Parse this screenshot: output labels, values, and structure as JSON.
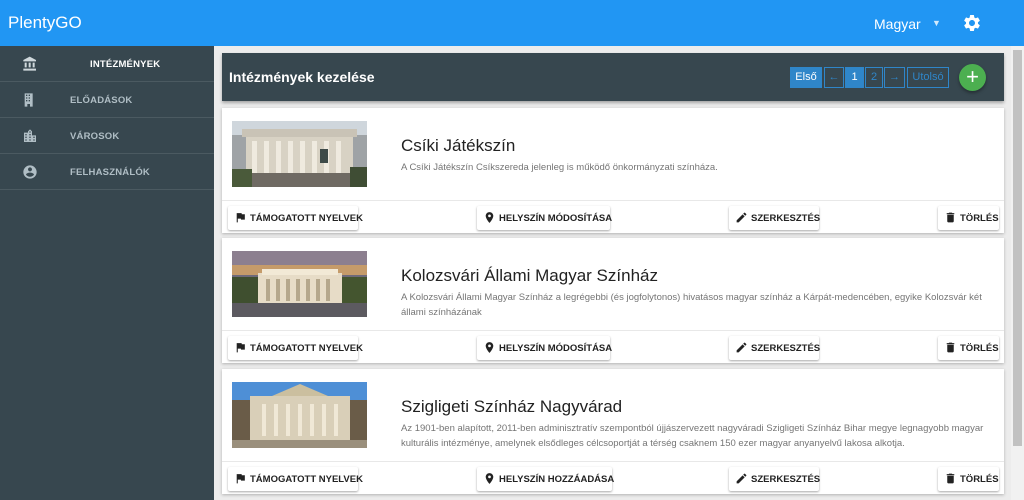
{
  "app": {
    "title": "PlentyGO"
  },
  "header_bar": {
    "language": "Magyar"
  },
  "sidebar": {
    "items": [
      {
        "label": "INTÉZMÉNYEK",
        "icon": "bank-icon",
        "active": true
      },
      {
        "label": "ELŐADÁSOK",
        "icon": "building-icon",
        "active": false
      },
      {
        "label": "VÁROSOK",
        "icon": "city-icon",
        "active": false
      },
      {
        "label": "FELHASZNÁLÓK",
        "icon": "account-circle-icon",
        "active": false
      }
    ]
  },
  "panel": {
    "title": "Intézmények kezelése",
    "pagination": {
      "first": "Első",
      "prev": "←",
      "pages": [
        "1",
        "2"
      ],
      "current": "1",
      "next": "→",
      "last": "Utolsó"
    },
    "add_label": "+"
  },
  "institutions": [
    {
      "name": "Csíki Játékszín",
      "description": "A Csíki Játékszín Csíkszereda jelenleg is működő önkormányzati színháza.",
      "actions": [
        "TÁMOGATOTT NYELVEK",
        "HELYSZÍN MÓDOSÍTÁSA",
        "SZERKESZTÉS",
        "TÖRLÉS"
      ]
    },
    {
      "name": "Kolozsvári Állami Magyar Színház",
      "description": "A Kolozsvári Állami Magyar Színház a legrégebbi (és jogfolytonos) hivatásos magyar színház a Kárpát-medencében, egyike Kolozsvár két állami színházának",
      "actions": [
        "TÁMOGATOTT NYELVEK",
        "HELYSZÍN MÓDOSÍTÁSA",
        "SZERKESZTÉS",
        "TÖRLÉS"
      ]
    },
    {
      "name": "Szigligeti Színház Nagyvárad",
      "description": "Az 1901-ben alapított, 2011-ben adminisztratív szempontból újjászervezett nagyváradi Szigligeti Színház Bihar megye legnagyobb magyar kulturális intézménye, amelynek elsődleges célcsoportját a térség csaknem 150 ezer magyar anyanyelvű lakosa alkotja.",
      "actions": [
        "TÁMOGATOTT NYELVEK",
        "HELYSZÍN HOZZÁADÁSA",
        "SZERKESZTÉS",
        "TÖRLÉS"
      ]
    }
  ],
  "colors": {
    "topbar": "#2196f3",
    "sidebar": "#37474f",
    "accent": "#2f86c9",
    "add": "#4caf50"
  }
}
